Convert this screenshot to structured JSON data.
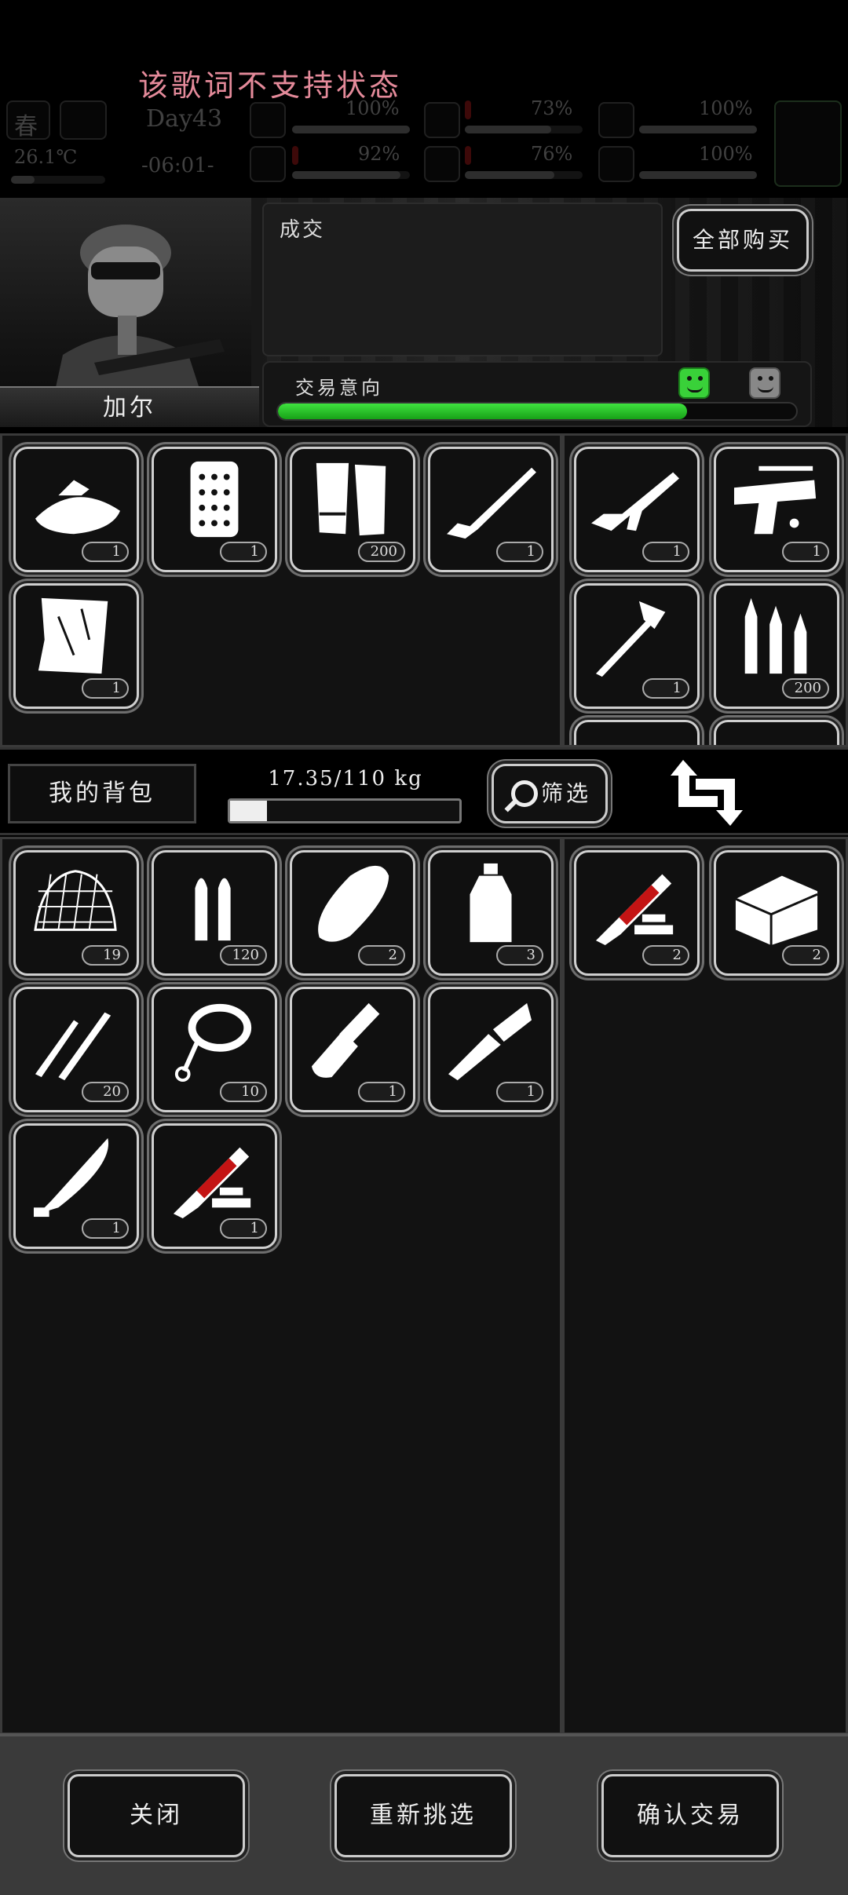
{
  "lyrics": "该歌词不支持状态",
  "hud": {
    "season": "春",
    "day": "Day43",
    "temperature": "26.1℃",
    "time": "-06:01-",
    "stats": [
      {
        "name": "health",
        "value": "100%"
      },
      {
        "name": "hunger",
        "value": "73%"
      },
      {
        "name": "armor",
        "value": "100%"
      },
      {
        "name": "stamina",
        "value": "92%"
      },
      {
        "name": "thirst",
        "value": "76%"
      },
      {
        "name": "heart",
        "value": "100%"
      }
    ]
  },
  "trader": {
    "name": "加尔",
    "dialog": "成交",
    "buy_all_label": "全部购买",
    "intent_label": "交易意向",
    "intent_level": 0.79
  },
  "trader_inventory": [
    {
      "icon": "tin-dish-icon",
      "qty": "1"
    },
    {
      "icon": "armor-plate-icon",
      "qty": "1"
    },
    {
      "icon": "paper-stack-icon",
      "qty": "200"
    },
    {
      "icon": "rifle-icon",
      "qty": "1"
    },
    {
      "icon": "tarp-icon",
      "qty": "1"
    }
  ],
  "trader_offer": [
    {
      "icon": "assault-rifle-icon",
      "qty": "1"
    },
    {
      "icon": "pistol-scope-icon",
      "qty": "1"
    },
    {
      "icon": "fire-axe-icon",
      "qty": "1"
    },
    {
      "icon": "rifle-ammo-icon",
      "qty": "200"
    }
  ],
  "bag": {
    "title": "我的背包",
    "weight": "17.35/110 kg",
    "weight_fill": 0.16,
    "filter_label": "筛选"
  },
  "player_inventory": [
    {
      "icon": "camo-net-icon",
      "qty": "19"
    },
    {
      "icon": "pistol-ammo-icon",
      "qty": "120"
    },
    {
      "icon": "bread-icon",
      "qty": "2"
    },
    {
      "icon": "water-bottle-icon",
      "qty": "3"
    },
    {
      "icon": "lockpick-icon",
      "qty": "20"
    },
    {
      "icon": "rope-icon",
      "qty": "10"
    },
    {
      "icon": "shovel-icon",
      "qty": "1"
    },
    {
      "icon": "hunting-knife-icon",
      "qty": "1"
    },
    {
      "icon": "machete-icon",
      "qty": "1"
    },
    {
      "icon": "syringe-icon",
      "qty": "1"
    }
  ],
  "player_offer": [
    {
      "icon": "syringe-icon",
      "qty": "2"
    },
    {
      "icon": "toolbox-icon",
      "qty": "2"
    }
  ],
  "footer": {
    "close_label": "关闭",
    "reselect_label": "重新挑选",
    "confirm_label": "确认交易"
  }
}
